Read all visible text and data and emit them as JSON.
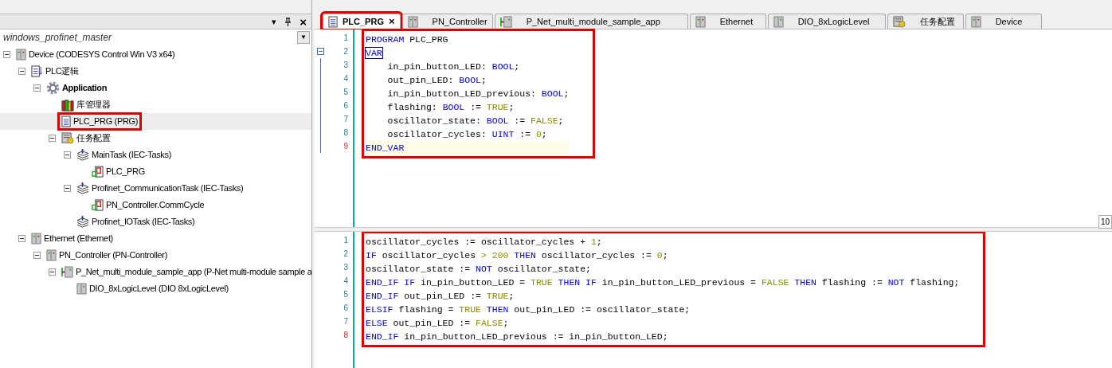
{
  "left_panel": {
    "menu_arrow": "▾",
    "close": "×",
    "project": "windows_profinet_master",
    "dropdown_arrow": "▼",
    "tree": [
      {
        "label": "Device (CODESYS Control Win V3 x64)",
        "kind": "device",
        "expanded": true,
        "selected": false,
        "highlighted": false,
        "children": [
          {
            "label": "PLC逻辑",
            "kind": "plc",
            "expanded": true,
            "selected": false,
            "highlighted": false,
            "children": [
              {
                "label": "Application",
                "kind": "application",
                "expanded": true,
                "selected": false,
                "highlighted": false,
                "children": [
                  {
                    "label": "库管理器",
                    "kind": "library",
                    "selected": false,
                    "highlighted": false
                  },
                  {
                    "label": "PLC_PRG (PRG)",
                    "kind": "pou",
                    "selected": true,
                    "highlighted": true
                  },
                  {
                    "label": "任务配置",
                    "kind": "taskconfig",
                    "expanded": true,
                    "selected": false,
                    "highlighted": false,
                    "children": [
                      {
                        "label": "MainTask (IEC-Tasks)",
                        "kind": "task",
                        "expanded": true,
                        "selected": false,
                        "highlighted": false,
                        "children": [
                          {
                            "label": "PLC_PRG",
                            "kind": "call",
                            "selected": false,
                            "highlighted": false
                          }
                        ]
                      },
                      {
                        "label": "Profinet_CommunicationTask (IEC-Tasks)",
                        "kind": "task",
                        "expanded": true,
                        "selected": false,
                        "highlighted": false,
                        "children": [
                          {
                            "label": "PN_Controller.CommCycle",
                            "kind": "call",
                            "selected": false,
                            "highlighted": false
                          }
                        ]
                      },
                      {
                        "label": "Profinet_IOTask (IEC-Tasks)",
                        "kind": "task",
                        "selected": false,
                        "highlighted": false
                      }
                    ]
                  }
                ]
              }
            ]
          },
          {
            "label": "Ethernet (Ethernet)",
            "kind": "device",
            "expanded": true,
            "selected": false,
            "highlighted": false,
            "children": [
              {
                "label": "PN_Controller (PN-Controller)",
                "kind": "device",
                "expanded": true,
                "selected": false,
                "highlighted": false,
                "children": [
                  {
                    "label": "P_Net_multi_module_sample_app (P-Net multi-module sample a",
                    "kind": "io",
                    "expanded": true,
                    "selected": false,
                    "highlighted": false,
                    "children": [
                      {
                        "label": "DIO_8xLogicLevel (DIO 8xLogicLevel)",
                        "kind": "module",
                        "selected": false,
                        "highlighted": false
                      }
                    ]
                  }
                ]
              }
            ]
          }
        ]
      }
    ]
  },
  "tabs": [
    {
      "label": "PLC_PRG",
      "kind": "pou",
      "selected": true,
      "highlighted": true,
      "close": "×"
    },
    {
      "label": "PN_Controller",
      "kind": "device",
      "selected": false,
      "highlighted": false
    },
    {
      "label": "P_Net_multi_module_sample_app",
      "kind": "io",
      "selected": false,
      "highlighted": false
    },
    {
      "label": "Ethernet",
      "kind": "device",
      "selected": false,
      "highlighted": false
    },
    {
      "label": "DIO_8xLogicLevel",
      "kind": "module",
      "selected": false,
      "highlighted": false
    },
    {
      "label": "任务配置",
      "kind": "taskconfig",
      "selected": false,
      "highlighted": false
    },
    {
      "label": "Device",
      "kind": "device",
      "selected": false,
      "highlighted": false
    }
  ],
  "declaration_editor": {
    "highlighted": true,
    "lines": [
      {
        "number": "1",
        "current": false,
        "fold": false,
        "tokens": [
          {
            "text": "PROGRAM",
            "kind": "keyword"
          },
          {
            "text": " PLC_PRG",
            "kind": "identifier"
          }
        ]
      },
      {
        "number": "2",
        "current": false,
        "fold": true,
        "tokens": [
          {
            "text": "VAR",
            "kind": "bracket_match"
          }
        ]
      },
      {
        "number": "3",
        "current": false,
        "fold": false,
        "tokens": [
          {
            "text": "    in_pin_button_LED: ",
            "kind": "identifier"
          },
          {
            "text": "BOOL",
            "kind": "keyword"
          },
          {
            "text": ";",
            "kind": "identifier"
          }
        ]
      },
      {
        "number": "4",
        "current": false,
        "fold": false,
        "tokens": [
          {
            "text": "    out_pin_LED: ",
            "kind": "identifier"
          },
          {
            "text": "BOOL",
            "kind": "keyword"
          },
          {
            "text": ";",
            "kind": "identifier"
          }
        ]
      },
      {
        "number": "5",
        "current": false,
        "fold": false,
        "tokens": [
          {
            "text": "    in_pin_button_LED_previous: ",
            "kind": "identifier"
          },
          {
            "text": "BOOL",
            "kind": "keyword"
          },
          {
            "text": ";",
            "kind": "identifier"
          }
        ]
      },
      {
        "number": "6",
        "current": false,
        "fold": false,
        "tokens": [
          {
            "text": "    flashing: ",
            "kind": "identifier"
          },
          {
            "text": "BOOL",
            "kind": "keyword"
          },
          {
            "text": " := ",
            "kind": "identifier"
          },
          {
            "text": "TRUE",
            "kind": "literal"
          },
          {
            "text": ";",
            "kind": "identifier"
          }
        ]
      },
      {
        "number": "7",
        "current": false,
        "fold": false,
        "tokens": [
          {
            "text": "    oscillator_state: ",
            "kind": "identifier"
          },
          {
            "text": "BOOL",
            "kind": "keyword"
          },
          {
            "text": " := ",
            "kind": "identifier"
          },
          {
            "text": "FALSE",
            "kind": "literal"
          },
          {
            "text": ";",
            "kind": "identifier"
          }
        ]
      },
      {
        "number": "8",
        "current": false,
        "fold": false,
        "tokens": [
          {
            "text": "    oscillator_cycles: ",
            "kind": "identifier"
          },
          {
            "text": "UINT",
            "kind": "keyword"
          },
          {
            "text": " := ",
            "kind": "identifier"
          },
          {
            "text": "0",
            "kind": "literal"
          },
          {
            "text": ";",
            "kind": "identifier"
          }
        ]
      },
      {
        "number": "9",
        "current": true,
        "fold": false,
        "tokens": [
          {
            "text": "END_VAR",
            "kind": "keyword"
          }
        ]
      }
    ]
  },
  "zoom_badge": "10",
  "implementation_editor": {
    "highlighted": true,
    "lines": [
      {
        "number": "1",
        "current": false,
        "tokens": [
          {
            "text": "oscillator_cycles := oscillator_cycles + ",
            "kind": "identifier"
          },
          {
            "text": "1",
            "kind": "literal"
          },
          {
            "text": ";",
            "kind": "identifier"
          }
        ]
      },
      {
        "number": "2",
        "current": false,
        "tokens": [
          {
            "text": "IF",
            "kind": "keyword"
          },
          {
            "text": " oscillator_cycles ",
            "kind": "identifier"
          },
          {
            "text": "> 200",
            "kind": "literal"
          },
          {
            "text": " THEN",
            "kind": "keyword"
          },
          {
            "text": " oscillator_cycles := ",
            "kind": "identifier"
          },
          {
            "text": "0",
            "kind": "literal"
          },
          {
            "text": ";",
            "kind": "identifier"
          }
        ]
      },
      {
        "number": "3",
        "current": false,
        "tokens": [
          {
            "text": "oscillator_state := ",
            "kind": "identifier"
          },
          {
            "text": "NOT",
            "kind": "keyword"
          },
          {
            "text": " oscillator_state;",
            "kind": "identifier"
          }
        ]
      },
      {
        "number": "4",
        "current": false,
        "tokens": [
          {
            "text": "END_IF IF",
            "kind": "keyword"
          },
          {
            "text": " in_pin_button_LED = ",
            "kind": "identifier"
          },
          {
            "text": "TRUE",
            "kind": "literal"
          },
          {
            "text": " THEN IF",
            "kind": "keyword"
          },
          {
            "text": " in_pin_button_LED_previous = ",
            "kind": "identifier"
          },
          {
            "text": "FALSE",
            "kind": "literal"
          },
          {
            "text": " THEN",
            "kind": "keyword"
          },
          {
            "text": " flashing := ",
            "kind": "identifier"
          },
          {
            "text": "NOT",
            "kind": "keyword"
          },
          {
            "text": " flashing;",
            "kind": "identifier"
          }
        ]
      },
      {
        "number": "5",
        "current": false,
        "tokens": [
          {
            "text": "END_IF",
            "kind": "keyword"
          },
          {
            "text": " out_pin_LED := ",
            "kind": "identifier"
          },
          {
            "text": "TRUE",
            "kind": "literal"
          },
          {
            "text": ";",
            "kind": "identifier"
          }
        ]
      },
      {
        "number": "6",
        "current": false,
        "tokens": [
          {
            "text": "ELSIF",
            "kind": "keyword"
          },
          {
            "text": " flashing = ",
            "kind": "identifier"
          },
          {
            "text": "TRUE",
            "kind": "literal"
          },
          {
            "text": " THEN",
            "kind": "keyword"
          },
          {
            "text": " out_pin_LED := oscillator_state;",
            "kind": "identifier"
          }
        ]
      },
      {
        "number": "7",
        "current": false,
        "tokens": [
          {
            "text": "ELSE",
            "kind": "keyword"
          },
          {
            "text": " out_pin_LED := ",
            "kind": "identifier"
          },
          {
            "text": "FALSE",
            "kind": "literal"
          },
          {
            "text": ";",
            "kind": "identifier"
          }
        ]
      },
      {
        "number": "8",
        "current": true,
        "tokens": [
          {
            "text": "END_IF",
            "kind": "keyword"
          },
          {
            "text": " in_pin_button_LED_previous := in_pin_button_LED;",
            "kind": "identifier"
          }
        ]
      }
    ]
  }
}
